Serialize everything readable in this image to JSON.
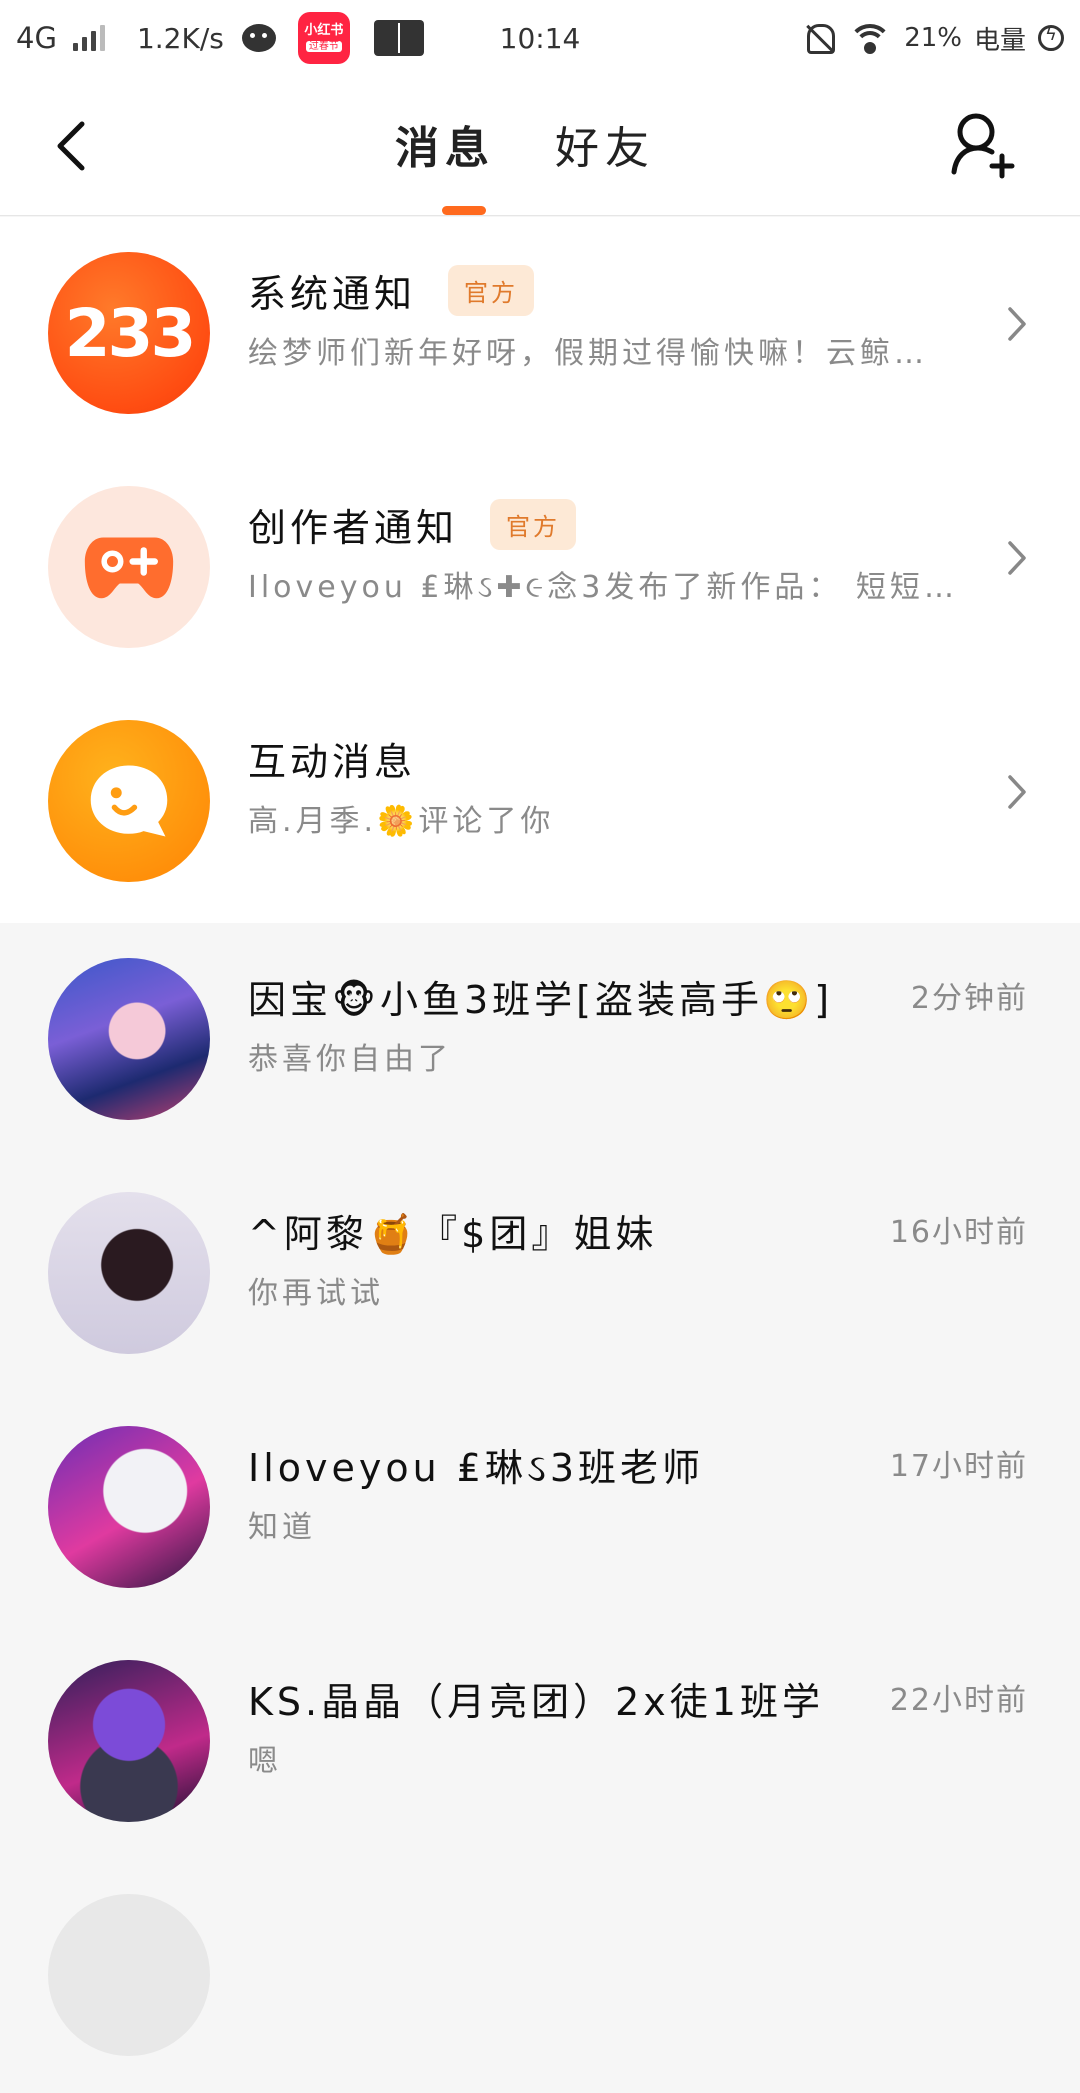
{
  "status_bar": {
    "network": "4G",
    "speed": "1.2K/s",
    "app_icon_text": "小红书",
    "app_icon_sub": "过春节",
    "time": "10:14",
    "battery": "21%",
    "battery_label": "电量"
  },
  "header": {
    "tabs": [
      {
        "label": "消息",
        "active": true
      },
      {
        "label": "好友",
        "active": false
      }
    ],
    "accent_color": "#ff6a1e"
  },
  "official_rows": [
    {
      "name": "系统通知",
      "badge": "官方",
      "preview": "绘梦师们新年好呀，假期过得愉快嘛！云鲸…",
      "avatar_text": "233",
      "icon": "233-logo-icon"
    },
    {
      "name": "创作者通知",
      "badge": "官方",
      "preview": "Iloveyou ₤琳ઽ✚૯念3发布了新作品： 短短的…",
      "icon": "gamepad-icon"
    },
    {
      "name": "互动消息",
      "badge": "",
      "preview": " 高.月季.🌼评论了你",
      "icon": "chat-bubble-icon"
    }
  ],
  "chat_rows": [
    {
      "name": "因宝🐵小鱼3班学[盗装高手🙄]",
      "preview": "恭喜你自由了",
      "time": "2分钟前"
    },
    {
      "name": "^阿黎🍯『$团』姐妹",
      "preview": "你再试试",
      "time": "16小时前"
    },
    {
      "name": "Iloveyou ₤琳ઽ3班老师",
      "preview": "知道",
      "time": "17小时前"
    },
    {
      "name": "KS.晶晶（月亮团）2x徒1班学",
      "preview": "嗯",
      "time": "22小时前"
    }
  ]
}
